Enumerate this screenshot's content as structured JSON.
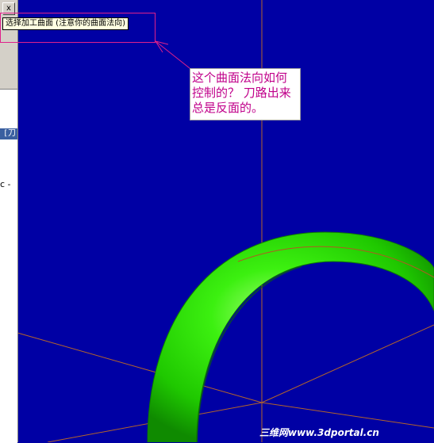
{
  "left_panel": {
    "close_glyph": "x",
    "selected_row_text": "[刀",
    "fragment_text": "c -"
  },
  "prompt": {
    "text": "选择加工曲面 (注意你的曲面法向)"
  },
  "annotation": {
    "text": "这个曲面法向如何控制的？  刀路出来总是反面的。"
  },
  "watermark": {
    "text": "三维网www.3dportal.cn"
  },
  "colors": {
    "viewport_background": "#0000a4",
    "axis_lines": "#b4642a",
    "ring": "#22e600",
    "annotation_text": "#c0008a",
    "highlight_outline": "#e0208a"
  }
}
